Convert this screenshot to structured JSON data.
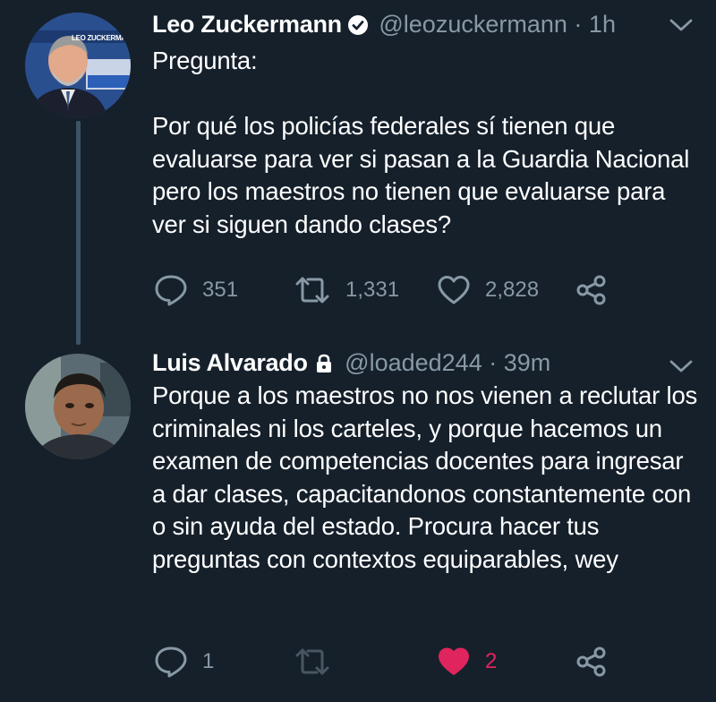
{
  "tweets": [
    {
      "name": "Leo Zuckermann",
      "handle": "@leozuckermann",
      "separator": "·",
      "time": "1h",
      "verified": true,
      "avatar_caption": "LEO ZUCKERMANN",
      "text": "Pregunta:\n\nPor qué los policías federales sí tienen que evaluarse para ver si pasan a la Guardia Nacional pero los maestros no tienen que evaluarse para ver si siguen dando clases?",
      "replies": "351",
      "retweets": "1,331",
      "likes": "2,828"
    },
    {
      "name": "Luis Alvarado",
      "handle": "@loaded244",
      "separator": "·",
      "time": "39m",
      "protected": true,
      "text": "Porque a los maestros no nos vienen a reclutar los criminales ni los carteles, y porque hacemos un examen de competencias docentes para ingresar a dar clases, capacitandonos constantemente con o sin ayuda del estado. Procura hacer tus preguntas con contextos equiparables, wey",
      "replies": "1",
      "retweets": "",
      "likes": "2",
      "liked": true
    }
  ],
  "colors": {
    "background": "#15202b",
    "secondary_text": "#8899a6",
    "like_active": "#e0245e"
  },
  "icons": [
    "verified-badge-icon",
    "lock-icon",
    "chevron-down-icon",
    "reply-icon",
    "retweet-icon",
    "like-icon",
    "share-icon"
  ]
}
